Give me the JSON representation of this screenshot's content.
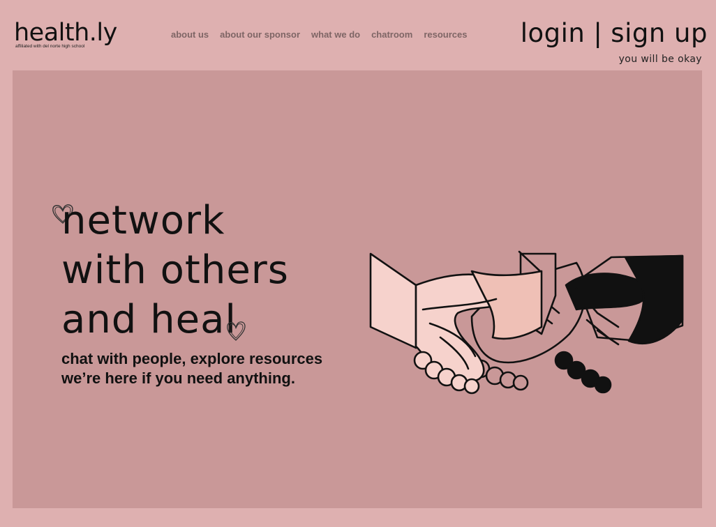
{
  "header": {
    "logo": "health.ly",
    "logo_sub": "affiliated with del norte high school",
    "nav": [
      "about us",
      "about our sponsor",
      "what we do",
      "chatroom",
      "resources"
    ],
    "login": "login",
    "separator": "|",
    "signup": "sign up",
    "tagline": "you will be okay"
  },
  "hero": {
    "title_lines": [
      "network",
      "with others",
      "and heal"
    ],
    "subtitle_lines": [
      "chat with people, explore resources",
      "we’re here if you need anything."
    ]
  },
  "icons": {
    "heart_left": "heart-outline-icon",
    "heart_right": "heart-outline-icon",
    "illustration": "handshake-illustration"
  },
  "colors": {
    "page_bg": "#deb0b0",
    "panel_bg": "#c99898",
    "nav_text": "#7e6565",
    "skin_light": "#f6d2cc",
    "skin_mid": "#efc0b6",
    "skin_dark": "#000000"
  }
}
